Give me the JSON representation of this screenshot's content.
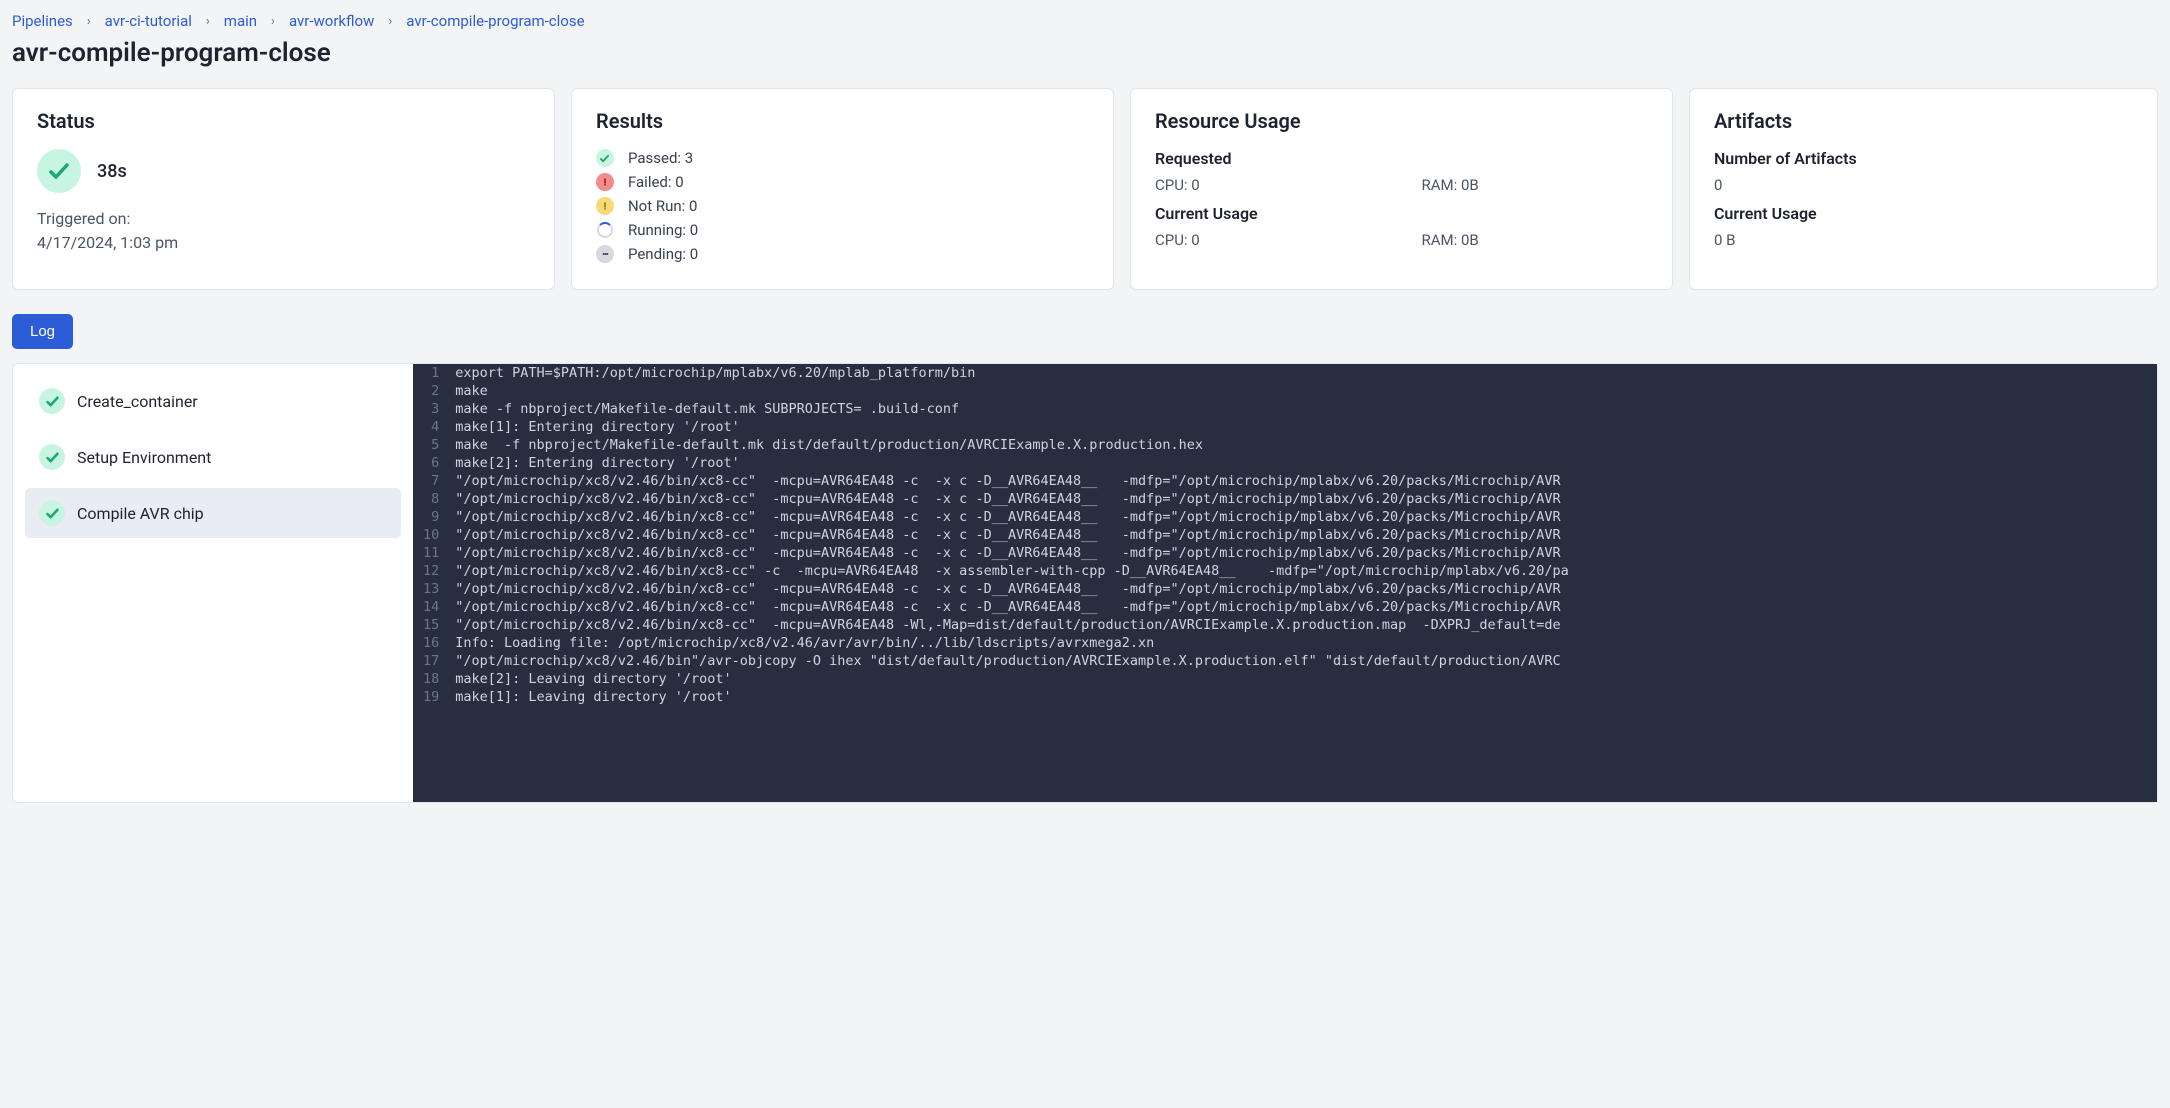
{
  "breadcrumb": {
    "items": [
      {
        "label": "Pipelines"
      },
      {
        "label": "avr-ci-tutorial"
      },
      {
        "label": "main"
      },
      {
        "label": "avr-workflow"
      },
      {
        "label": "avr-compile-program-close"
      }
    ]
  },
  "page": {
    "title": "avr-compile-program-close"
  },
  "status": {
    "heading": "Status",
    "duration": "38s",
    "triggered_label": "Triggered on:",
    "triggered_value": "4/17/2024, 1:03 pm"
  },
  "results": {
    "heading": "Results",
    "passed": "Passed: 3",
    "failed": "Failed: 0",
    "not_run": "Not Run: 0",
    "running": "Running: 0",
    "pending": "Pending: 0"
  },
  "resource_usage": {
    "heading": "Resource Usage",
    "requested_label": "Requested",
    "req_cpu": "CPU: 0",
    "req_ram": "RAM: 0B",
    "current_label": "Current Usage",
    "cur_cpu": "CPU: 0",
    "cur_ram": "RAM: 0B"
  },
  "artifacts": {
    "heading": "Artifacts",
    "count_label": "Number of Artifacts",
    "count_value": "0",
    "current_label": "Current Usage",
    "current_value": "0 B"
  },
  "tabs": {
    "log": "Log"
  },
  "steps": {
    "items": [
      {
        "label": "Create_container"
      },
      {
        "label": "Setup Environment"
      },
      {
        "label": "Compile AVR chip"
      }
    ],
    "selected_index": 2
  },
  "log": {
    "lines": [
      "export PATH=$PATH:/opt/microchip/mplabx/v6.20/mplab_platform/bin",
      "make",
      "make -f nbproject/Makefile-default.mk SUBPROJECTS= .build-conf",
      "make[1]: Entering directory '/root'",
      "make  -f nbproject/Makefile-default.mk dist/default/production/AVRCIExample.X.production.hex",
      "make[2]: Entering directory '/root'",
      "\"/opt/microchip/xc8/v2.46/bin/xc8-cc\"  -mcpu=AVR64EA48 -c  -x c -D__AVR64EA48__   -mdfp=\"/opt/microchip/mplabx/v6.20/packs/Microchip/AVR",
      "\"/opt/microchip/xc8/v2.46/bin/xc8-cc\"  -mcpu=AVR64EA48 -c  -x c -D__AVR64EA48__   -mdfp=\"/opt/microchip/mplabx/v6.20/packs/Microchip/AVR",
      "\"/opt/microchip/xc8/v2.46/bin/xc8-cc\"  -mcpu=AVR64EA48 -c  -x c -D__AVR64EA48__   -mdfp=\"/opt/microchip/mplabx/v6.20/packs/Microchip/AVR",
      "\"/opt/microchip/xc8/v2.46/bin/xc8-cc\"  -mcpu=AVR64EA48 -c  -x c -D__AVR64EA48__   -mdfp=\"/opt/microchip/mplabx/v6.20/packs/Microchip/AVR",
      "\"/opt/microchip/xc8/v2.46/bin/xc8-cc\"  -mcpu=AVR64EA48 -c  -x c -D__AVR64EA48__   -mdfp=\"/opt/microchip/mplabx/v6.20/packs/Microchip/AVR",
      "\"/opt/microchip/xc8/v2.46/bin/xc8-cc\" -c  -mcpu=AVR64EA48  -x assembler-with-cpp -D__AVR64EA48__    -mdfp=\"/opt/microchip/mplabx/v6.20/pa",
      "\"/opt/microchip/xc8/v2.46/bin/xc8-cc\"  -mcpu=AVR64EA48 -c  -x c -D__AVR64EA48__   -mdfp=\"/opt/microchip/mplabx/v6.20/packs/Microchip/AVR",
      "\"/opt/microchip/xc8/v2.46/bin/xc8-cc\"  -mcpu=AVR64EA48 -c  -x c -D__AVR64EA48__   -mdfp=\"/opt/microchip/mplabx/v6.20/packs/Microchip/AVR",
      "\"/opt/microchip/xc8/v2.46/bin/xc8-cc\"  -mcpu=AVR64EA48 -Wl,-Map=dist/default/production/AVRCIExample.X.production.map  -DXPRJ_default=de",
      "Info: Loading file: /opt/microchip/xc8/v2.46/avr/avr/bin/../lib/ldscripts/avrxmega2.xn",
      "\"/opt/microchip/xc8/v2.46/bin\"/avr-objcopy -O ihex \"dist/default/production/AVRCIExample.X.production.elf\" \"dist/default/production/AVRC",
      "make[2]: Leaving directory '/root'",
      "make[1]: Leaving directory '/root'"
    ]
  }
}
